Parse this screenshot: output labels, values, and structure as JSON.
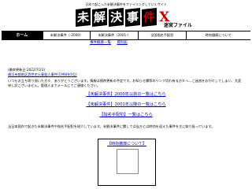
{
  "header": {
    "tagline": "日本で起こった未解決事件をファイリングしていくサイト",
    "logo_chars": [
      "未",
      "解",
      "決",
      "事",
      "件"
    ],
    "logo_x": "X",
    "logo_subtitle": "迷宮ファイル"
  },
  "nav": {
    "items": [
      "ホーム",
      "未解決事件（-2000）",
      "未解決事件（2001-）",
      "全国指名手配犯",
      "時効撤廃について"
    ]
  },
  "subnav": {
    "items": [
      "事件概要一覧",
      "資料館"
    ]
  },
  "content": {
    "updated": "(最終更新日:2022/7/23)",
    "latest_link": "横浜市都筑区男性宅火事殺人事件(1998年9月)",
    "para": "いつもお立ち寄り頂いた方々、ありがとうございます。情報は随時更新の予定です。お知らせ欄等のリンク切れ有る方々へ…ご迷惑をおかけしてしまい、大変申し訳ございません。管理人までメールにてご連絡ください。",
    "links": [
      "【未解決事件】2000年以前の一覧はこちら",
      "【未解決事件】2001年以降の一覧はこちら",
      "【指名手配犯】一覧はこちら"
    ],
    "para2": "当日本国内で起きた未解決事件や指名手配犯を紹介しています。未解決事件に関しては当方とは時効を迎えた事件を主に取り扱っています。",
    "banner_title": "【時効撤廃について】"
  }
}
